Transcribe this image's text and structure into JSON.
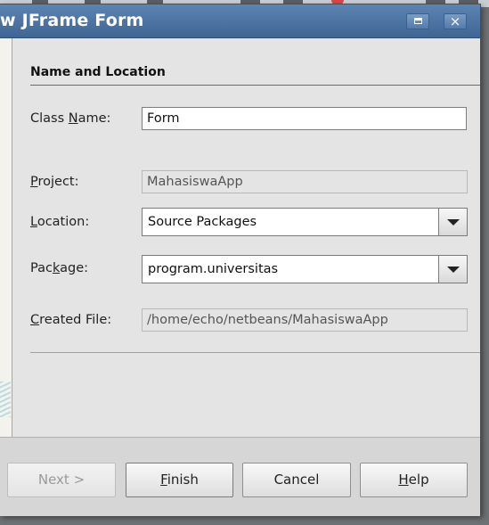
{
  "window": {
    "title": "w JFrame Form",
    "maximize_icon": "maximize-icon",
    "close_icon": "close-icon",
    "close_glyph": "×"
  },
  "section": {
    "title": "Name and Location"
  },
  "form": {
    "class_name": {
      "label_mnemonic_before": "Class ",
      "label_mnemonic": "N",
      "label_after": "ame:",
      "value": "Form"
    },
    "project": {
      "label_mnemonic_before": "",
      "label_mnemonic": "P",
      "label_after": "roject:",
      "value": "MahasiswaApp"
    },
    "location": {
      "label_mnemonic_before": "",
      "label_mnemonic": "L",
      "label_after": "ocation:",
      "value": "Source Packages"
    },
    "package": {
      "label_mnemonic_before": "Pac",
      "label_mnemonic": "k",
      "label_after": "age:",
      "value": "program.universitas"
    },
    "created_file": {
      "label_mnemonic_before": "",
      "label_mnemonic": "C",
      "label_after": "reated File:",
      "value": "/home/echo/netbeans/MahasiswaApp"
    }
  },
  "buttons": {
    "next": "Next >",
    "finish_mnemonic": "F",
    "finish_rest": "inish",
    "cancel": "Cancel",
    "help_mnemonic": "H",
    "help_rest": "elp"
  }
}
